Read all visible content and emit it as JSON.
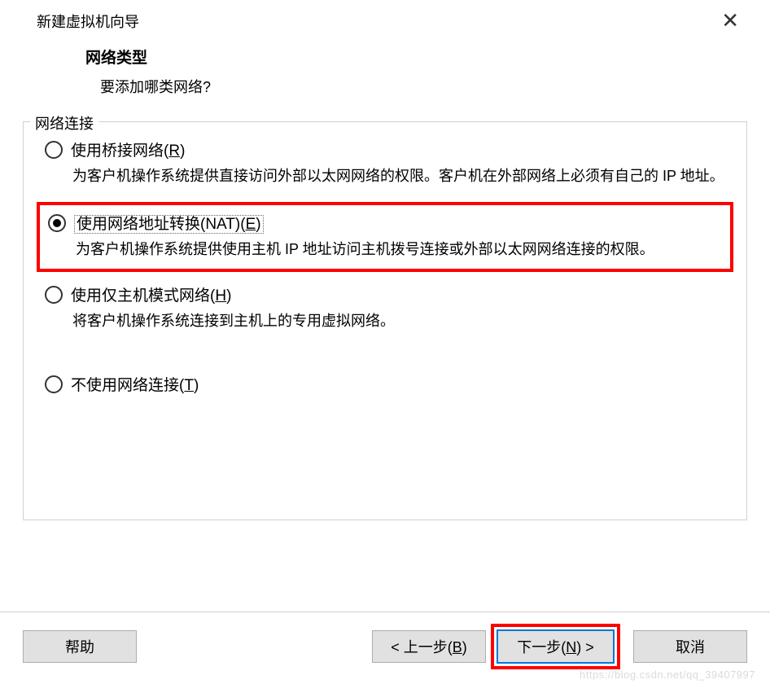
{
  "titlebar": {
    "title": "新建虚拟机向导"
  },
  "header": {
    "title": "网络类型",
    "subtitle": "要添加哪类网络?"
  },
  "fieldset_legend": "网络连接",
  "options": {
    "bridged": {
      "label_text": "使用桥接网络",
      "suffix_open": "(",
      "suffix_letter": "R",
      "suffix_close": ")",
      "desc": "为客户机操作系统提供直接访问外部以太网网络的权限。客户机在外部网络上必须有自己的 IP 地址。"
    },
    "nat": {
      "label_text": "使用网络地址转换(NAT)",
      "suffix_open": "(",
      "suffix_letter": "E",
      "suffix_close": ")",
      "desc": "为客户机操作系统提供使用主机 IP 地址访问主机拨号连接或外部以太网网络连接的权限。"
    },
    "hostonly": {
      "label_text": "使用仅主机模式网络",
      "suffix_open": "(",
      "suffix_letter": "H",
      "suffix_close": ")",
      "desc": "将客户机操作系统连接到主机上的专用虚拟网络。"
    },
    "none": {
      "label_text": "不使用网络连接",
      "suffix_open": "(",
      "suffix_letter": "T",
      "suffix_close": ")"
    }
  },
  "buttons": {
    "help": "帮助",
    "back_prefix": "< 上一步(",
    "back_letter": "B",
    "back_suffix": ")",
    "next_prefix": "下一步(",
    "next_letter": "N",
    "next_suffix": ") >",
    "cancel": "取消"
  },
  "watermark": "https://blog.csdn.net/qq_39407997"
}
